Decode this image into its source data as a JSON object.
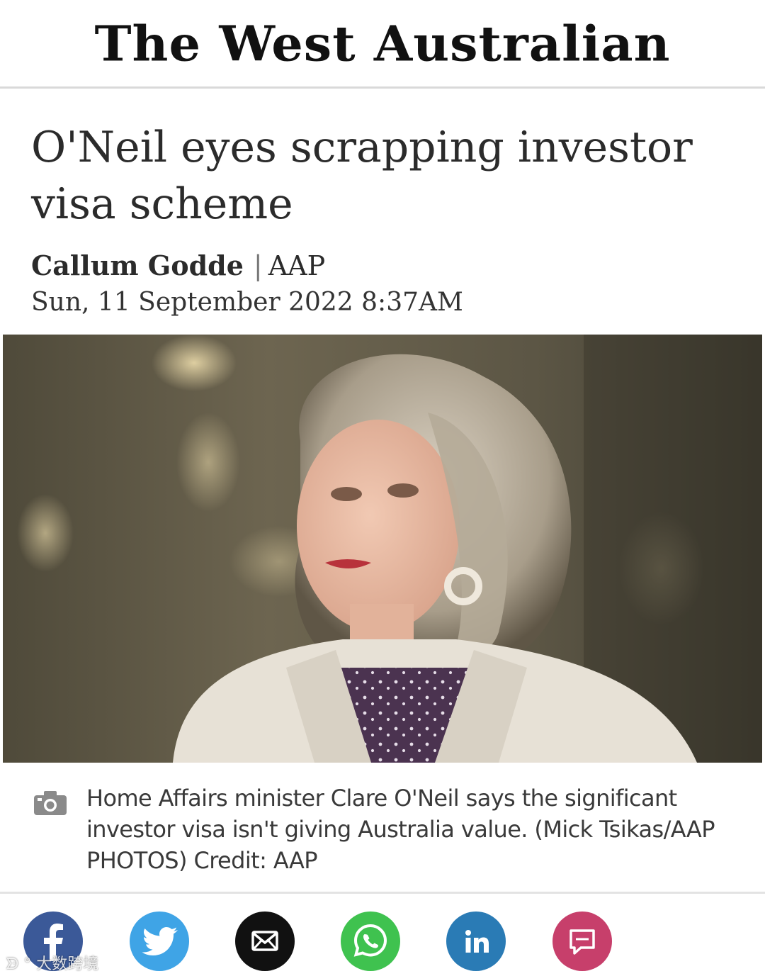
{
  "masthead": {
    "title": "The West Australian"
  },
  "article": {
    "headline": "O'Neil eyes scrapping investor visa scheme",
    "author": "Callum Godde",
    "separator": "|",
    "source": "AAP",
    "date": "Sun, 11 September 2022 8:37AM",
    "caption": "Home Affairs minister Clare O'Neil says the significant investor visa isn't giving Australia value. (Mick Tsikas/AAP PHOTOS) Credit: AAP"
  },
  "share": {
    "buttons": [
      {
        "icon": "facebook-icon",
        "color": "#3b5998"
      },
      {
        "icon": "twitter-icon",
        "color": "#3fa4e6"
      },
      {
        "icon": "email-icon",
        "color": "#111111"
      },
      {
        "icon": "whatsapp-icon",
        "color": "#3fc24f"
      },
      {
        "icon": "linkedin-icon",
        "color": "#2a7bb5"
      },
      {
        "icon": "comment-icon",
        "color": "#c73f6b"
      }
    ]
  },
  "watermark": {
    "text": "大数跨境"
  }
}
